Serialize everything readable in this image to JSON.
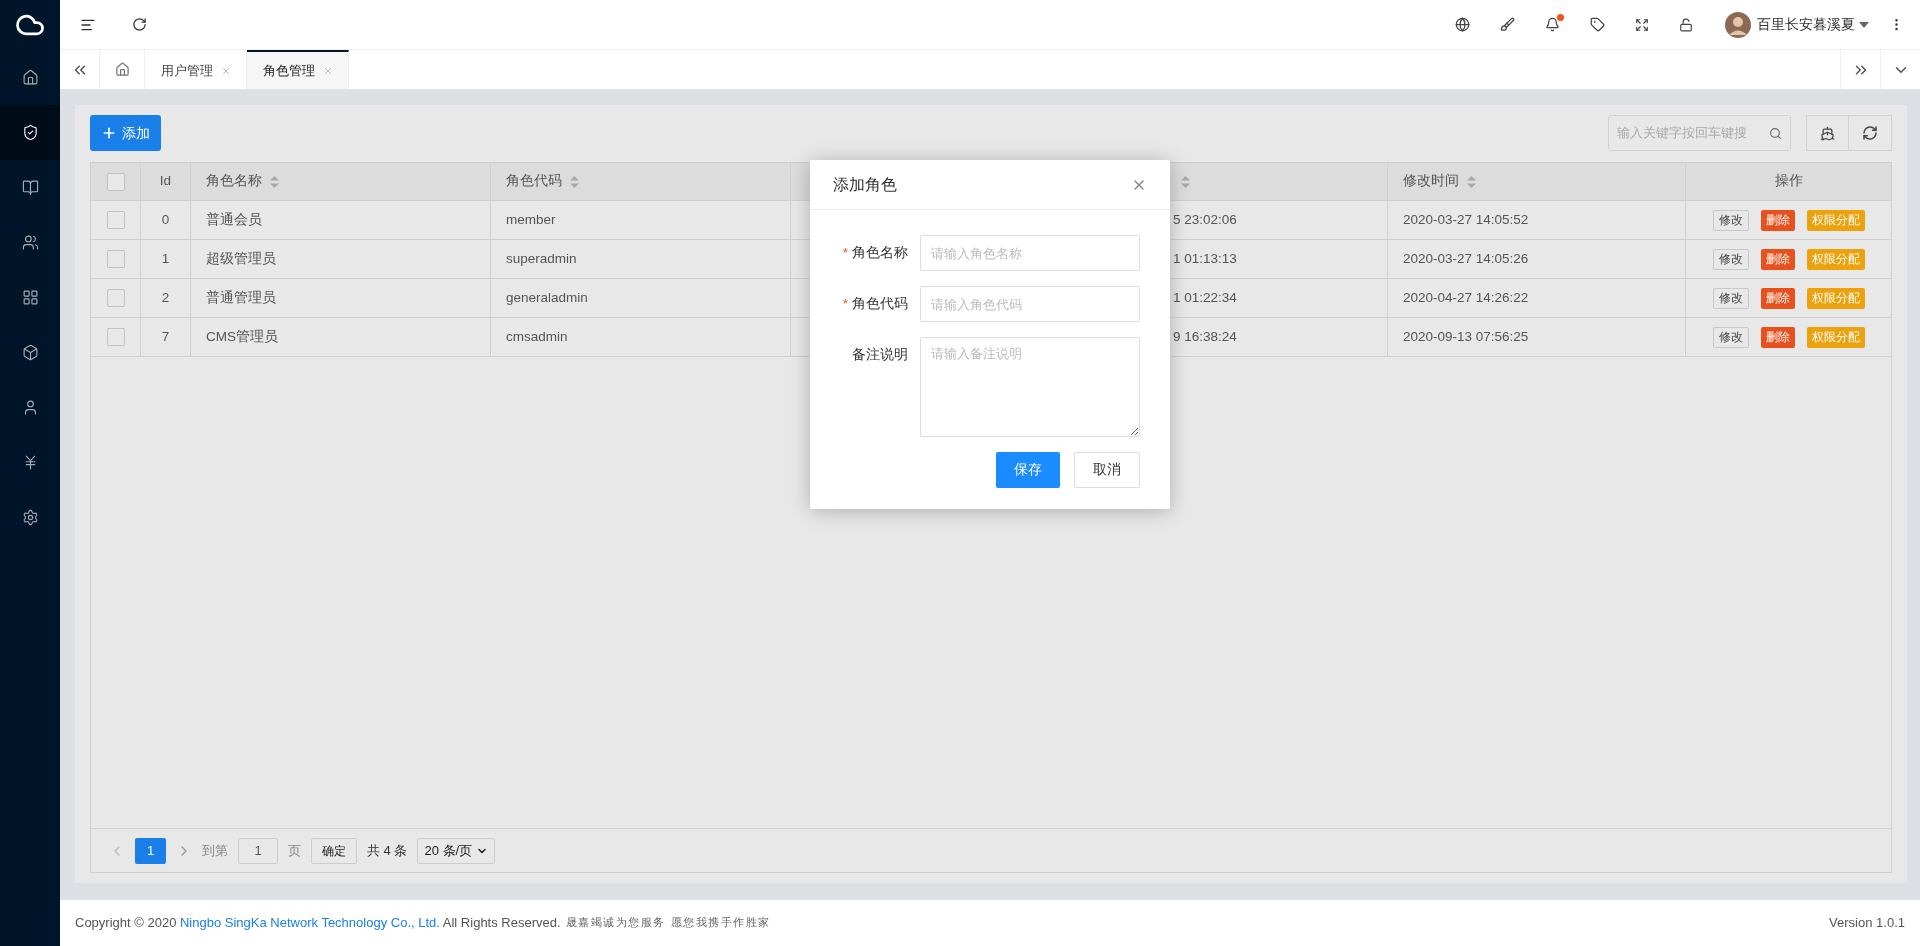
{
  "sidebar": {
    "items": [
      {
        "kind": "home",
        "selected": false
      },
      {
        "kind": "shield",
        "selected": true
      },
      {
        "kind": "book",
        "selected": false
      },
      {
        "kind": "users",
        "selected": false
      },
      {
        "kind": "grid",
        "selected": false
      },
      {
        "kind": "box",
        "selected": false
      },
      {
        "kind": "user",
        "selected": false
      },
      {
        "kind": "yen",
        "selected": false
      },
      {
        "kind": "settings",
        "selected": false
      }
    ]
  },
  "header": {
    "notification_dot": true,
    "user_name": "百里长安暮溪夏"
  },
  "tabs": [
    {
      "label": "用户管理",
      "selected": false
    },
    {
      "label": "角色管理",
      "selected": true
    }
  ],
  "toolbar": {
    "add_button": "添加",
    "search": {
      "placeholder": "输入关键字按回车键搜"
    }
  },
  "table": {
    "header_checked": false,
    "columns": [
      {
        "label": "Id",
        "sortable": false
      },
      {
        "label": "角色名称",
        "sortable": true
      },
      {
        "label": "角色代码",
        "sortable": true
      },
      {
        "sortable": true
      },
      {
        "label": "修改时间",
        "sortable": true
      },
      {
        "label": "操作",
        "sortable": false
      }
    ],
    "rows": [
      {
        "checked": false,
        "id": "0",
        "name": "普通会员",
        "code": "member",
        "column_5": "5 23:02:06",
        "modified": "2020-03-27 14:05:52",
        "actions": [
          "修改",
          "删除",
          "权限分配"
        ]
      },
      {
        "checked": false,
        "id": "1",
        "name": "超级管理员",
        "code": "superadmin",
        "column_5": "1 01:13:13",
        "modified": "2020-03-27 14:05:26",
        "actions": [
          "修改",
          "删除",
          "权限分配"
        ]
      },
      {
        "checked": false,
        "id": "2",
        "name": "普通管理员",
        "code": "generaladmin",
        "column_5": "1 01:22:34",
        "modified": "2020-04-27 14:26:22",
        "actions": [
          "修改",
          "删除",
          "权限分配"
        ]
      },
      {
        "checked": false,
        "id": "7",
        "name": "CMS管理员",
        "code": "cmsadmin",
        "column_5": "9 16:38:24",
        "modified": "2020-09-13 07:56:25",
        "actions": [
          "修改",
          "删除",
          "权限分配"
        ]
      }
    ]
  },
  "pagination": {
    "pages": [
      {
        "label": "1",
        "selected": true
      }
    ],
    "goto_label": "到第",
    "goto_value": "1",
    "page_unit": "页",
    "confirm": "确定",
    "total": "共 4 条",
    "page_size": "20 条/页"
  },
  "dialog": {
    "title": "添加角色",
    "fields": [
      {
        "kind": "input",
        "required_mark": "*",
        "label": "角色名称",
        "placeholder": "请输入角色名称"
      },
      {
        "kind": "input",
        "required_mark": "*",
        "label": "角色代码",
        "placeholder": "请输入角色代码"
      },
      {
        "kind": "textarea",
        "label": "备注说明",
        "placeholder": "请输入备注说明"
      }
    ],
    "buttons": [
      {
        "label": "保存",
        "primary": true
      },
      {
        "label": "取消",
        "primary": false
      }
    ]
  },
  "footer": {
    "copyright": "Copyright © 2020",
    "company": "Ningbo SingKa Network Technology Co., Ltd.",
    "rights": "All Rights Reserved.",
    "slogan": "晟嘉竭诚为您服务 愿您我携手作胜家",
    "version": "Version 1.0.1"
  }
}
